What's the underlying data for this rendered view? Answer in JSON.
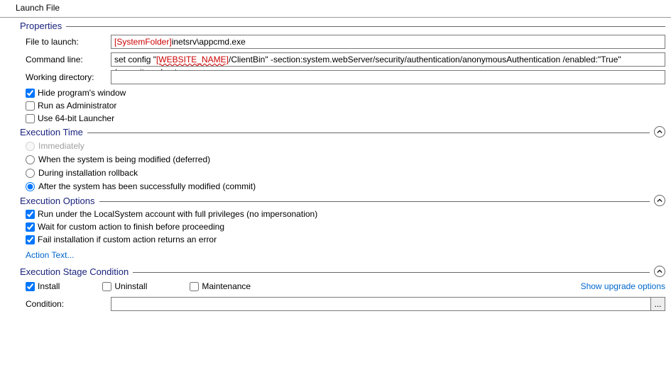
{
  "header": {
    "title": "Launch File"
  },
  "properties": {
    "title": "Properties",
    "file_label": "File to launch:",
    "file_prefix": "[SystemFolder]",
    "file_rest": "inetsrv\\appcmd.exe",
    "cmd_label": "Command line:",
    "cmd_pre": "set config \"",
    "cmd_placeholder": "[WEBSITE_NAME]",
    "cmd_post": "/ClientBin\" -section:system.webServer/security/authentication/anonymousAuthentication /enabled:\"True\" /commit:apphost",
    "wd_label": "Working directory:",
    "cb_hide": "Hide program's window",
    "cb_admin": "Run as Administrator",
    "cb_64": "Use 64-bit Launcher"
  },
  "exec_time": {
    "title": "Execution Time",
    "rb_immediate": "Immediately",
    "rb_deferred": "When the system is being modified (deferred)",
    "rb_rollback": "During installation rollback",
    "rb_commit": "After the system has been successfully modified (commit)"
  },
  "exec_opts": {
    "title": "Execution Options",
    "cb_localsystem": "Run under the LocalSystem account with full privileges (no impersonation)",
    "cb_wait": "Wait for custom action to finish before proceeding",
    "cb_fail": "Fail installation if custom action returns an error",
    "link": "Action Text..."
  },
  "stage": {
    "title": "Execution Stage Condition",
    "cb_install": "Install",
    "cb_uninstall": "Uninstall",
    "cb_maint": "Maintenance",
    "upgrade_link": "Show upgrade options",
    "cond_label": "Condition:",
    "cond_value": "",
    "cond_btn": "..."
  }
}
